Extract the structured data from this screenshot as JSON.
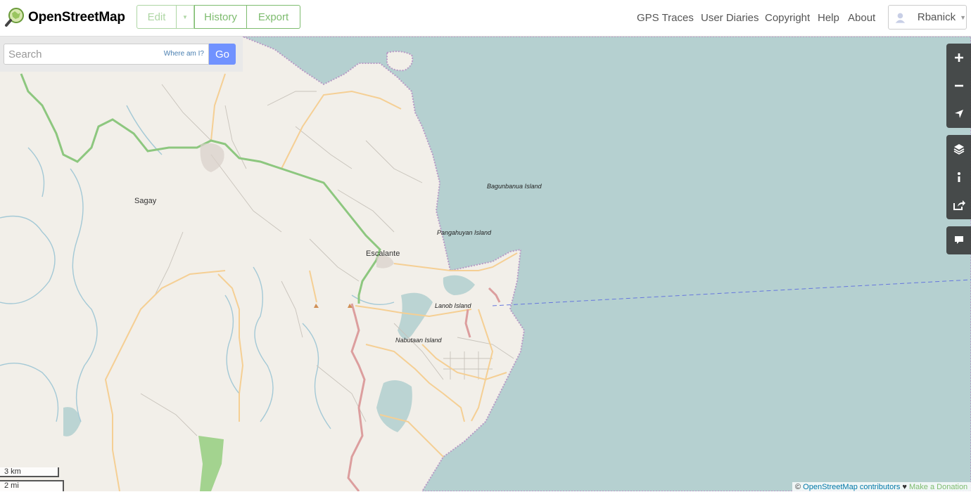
{
  "header": {
    "brand": "OpenStreetMap",
    "buttons": {
      "edit": "Edit",
      "history": "History",
      "export": "Export"
    },
    "nav": [
      "GPS Traces",
      "User Diaries",
      "Copyright",
      "Help",
      "About"
    ],
    "user": "Rbanick"
  },
  "search": {
    "placeholder": "Search",
    "where_am_i": "Where am I?",
    "go": "Go"
  },
  "map": {
    "labels": {
      "sagay": "Sagay",
      "escalante": "Escalante",
      "bagunbanua": "Bagunbanua Island",
      "pangahuyan": "Pangahuyan Island",
      "lanob": "Lanob Island",
      "nabutaan": "Nabutaan Island"
    },
    "scale": {
      "metric": "3 km",
      "imperial": "2 mi"
    },
    "attribution": {
      "prefix": "© ",
      "contributors": "OpenStreetMap contributors",
      "heart": " ♥ ",
      "donate": "Make a Donation"
    },
    "colors": {
      "land": "#f2efe9",
      "water": "#b5d0d0",
      "trunk": "#8dc77f",
      "primary": "#dc9e9e",
      "secondary": "#f5cf94",
      "accent": "#7ebc6f",
      "go_button": "#7092ff"
    }
  },
  "controls": [
    "zoom-in-icon",
    "zoom-out-icon",
    "locate-icon",
    "layers-icon",
    "info-icon",
    "share-icon",
    "note-icon"
  ]
}
